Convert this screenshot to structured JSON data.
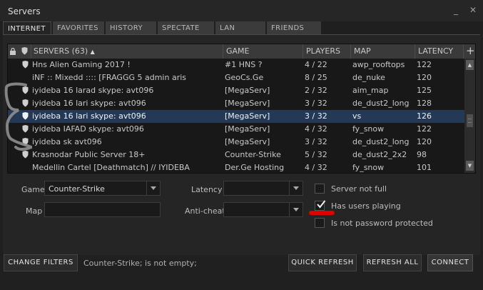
{
  "window": {
    "title": "Servers"
  },
  "tabs": [
    {
      "label": "INTERNET",
      "active": true
    },
    {
      "label": "FAVORITES",
      "active": false
    },
    {
      "label": "HISTORY",
      "active": false
    },
    {
      "label": "SPECTATE",
      "active": false
    },
    {
      "label": "LAN",
      "active": false
    },
    {
      "label": "FRIENDS",
      "active": false
    }
  ],
  "table": {
    "columns": {
      "servers": "SERVERS (63)",
      "game": "GAME",
      "players": "PLAYERS",
      "map": "MAP",
      "latency": "LATENCY"
    },
    "rows": [
      {
        "name": "Hns Alien Gaming 2017 !",
        "game": "#1 HNS ?",
        "players": "4 / 22",
        "map": "awp_rooftops",
        "latency": "122",
        "secure": true,
        "selected": false
      },
      {
        "name": "iNF :: Mixedd :::: [FRAGGG 5 admin aris",
        "game": "GeoCs.Ge",
        "players": "8 / 25",
        "map": "de_nuke",
        "latency": "120",
        "secure": false,
        "selected": false
      },
      {
        "name": "iyideba 16 larad skype: avt096",
        "game": "[MegaServ]",
        "players": "2 / 32",
        "map": "aim_map",
        "latency": "125",
        "secure": true,
        "selected": false
      },
      {
        "name": "iyideba 16 lari skype: avt096",
        "game": "[MegaServ]",
        "players": "3 / 32",
        "map": "de_dust2_long",
        "latency": "128",
        "secure": true,
        "selected": false
      },
      {
        "name": "iyideba 16 lari skype: avt096",
        "game": "[MegaServ]",
        "players": "3 / 32",
        "map": "vs",
        "latency": "126",
        "secure": true,
        "selected": true
      },
      {
        "name": "iyideba IAFAD skype: avt096",
        "game": "[MegaServ]",
        "players": "4 / 32",
        "map": "fy_snow",
        "latency": "122",
        "secure": true,
        "selected": false
      },
      {
        "name": "iyideba sk avt096",
        "game": "[MegaServ]",
        "players": "3 / 32",
        "map": "de_dust2_long",
        "latency": "120",
        "secure": true,
        "selected": false
      },
      {
        "name": "Krasnodar Public Server 18+",
        "game": "Counter-Strike",
        "players": "5 / 32",
        "map": "de_dust2_2x2",
        "latency": "98",
        "secure": true,
        "selected": false
      },
      {
        "name": "Medellin Cartel [Deathmatch] // IYIDEBA",
        "game": "Der.Ge Hosting",
        "players": "4 / 32",
        "map": "fy_snow",
        "latency": "101",
        "secure": false,
        "selected": false
      }
    ]
  },
  "filters": {
    "game_label": "Game",
    "game_value": "Counter-Strike",
    "map_label": "Map",
    "map_value": "",
    "latency_label": "Latency",
    "latency_value": "",
    "anticheat_label": "Anti-cheat",
    "anticheat_value": "",
    "server_not_full": {
      "label": "Server not full",
      "checked": false
    },
    "has_users_playing": {
      "label": "Has users playing",
      "checked": true
    },
    "not_password_protected": {
      "label": "Is not password protected",
      "checked": false
    }
  },
  "bottom": {
    "change_filters": "CHANGE FILTERS",
    "filter_status": "Counter-Strike; is not empty;",
    "quick_refresh": "QUICK REFRESH",
    "refresh_all": "REFRESH ALL",
    "connect": "CONNECT"
  },
  "colors": {
    "accent_mark": "#e00000",
    "selected_row": "#243956",
    "background": "#1f1f1f"
  }
}
